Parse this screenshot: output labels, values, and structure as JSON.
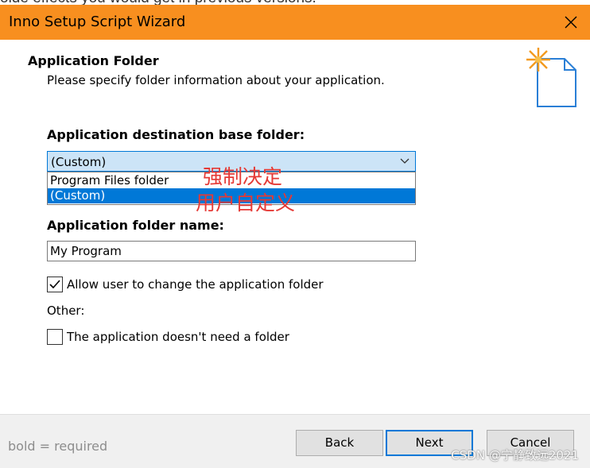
{
  "background_fragment": "olde effects you would get in previous versions.",
  "window": {
    "title": "Inno Setup Script Wizard",
    "accent_color": "#f88f1f"
  },
  "header": {
    "title": "Application Folder",
    "subtitle": "Please specify folder information about your application.",
    "icon": "wizard-document-icon"
  },
  "form": {
    "base_folder_label": "Application destination base folder:",
    "base_folder_value": "(Custom)",
    "base_folder_options": [
      {
        "label": "Program Files folder",
        "selected": false
      },
      {
        "label": "(Custom)",
        "selected": true
      }
    ],
    "folder_name_label": "Application folder name:",
    "folder_name_value": "My Program",
    "allow_change_label": "Allow user to change the application folder",
    "allow_change_checked": true,
    "other_label": "Other:",
    "no_folder_label": "The application doesn't need a folder",
    "no_folder_checked": false
  },
  "annotation": {
    "line1": "强制决定",
    "line2": "用户自定义",
    "color": "#e53935"
  },
  "footer": {
    "required_note": "bold = required",
    "back_label": "Back",
    "next_label": "Next",
    "cancel_label": "Cancel"
  },
  "watermark": "CSDN @宁静致远2021"
}
